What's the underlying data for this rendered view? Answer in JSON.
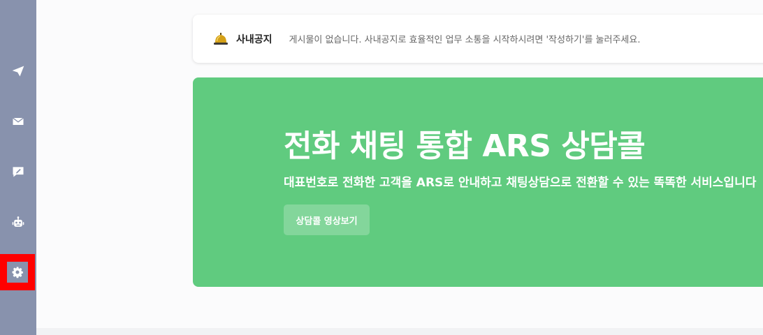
{
  "sidebar": {
    "items": [
      {
        "icon": "paper-plane-icon",
        "label": ""
      },
      {
        "icon": "envelope-icon",
        "label": ""
      },
      {
        "icon": "chat-edit-icon",
        "label": ""
      },
      {
        "icon": "robot-icon",
        "label": ""
      },
      {
        "icon": "gear-icon",
        "label": "",
        "highlighted": true
      }
    ],
    "background": "#8892ad",
    "highlight_color": "#ff0000"
  },
  "notice": {
    "icon": "bell-icon",
    "title": "사내공지",
    "message": "게시물이 없습니다. 사내공지로 효율적인 업무 소통을 시작하시려면 '작성하기'를 눌러주세요."
  },
  "banner": {
    "background": "#60cb7f",
    "title": "전화 채팅 통합 ARS 상담콜",
    "subtitle": "대표번호로 전화한 고객을 ARS로 안내하고 채팅상담으로 전환할 수 있는 똑똑한 서비스입니다",
    "button_label": "상담콜 영상보기"
  }
}
